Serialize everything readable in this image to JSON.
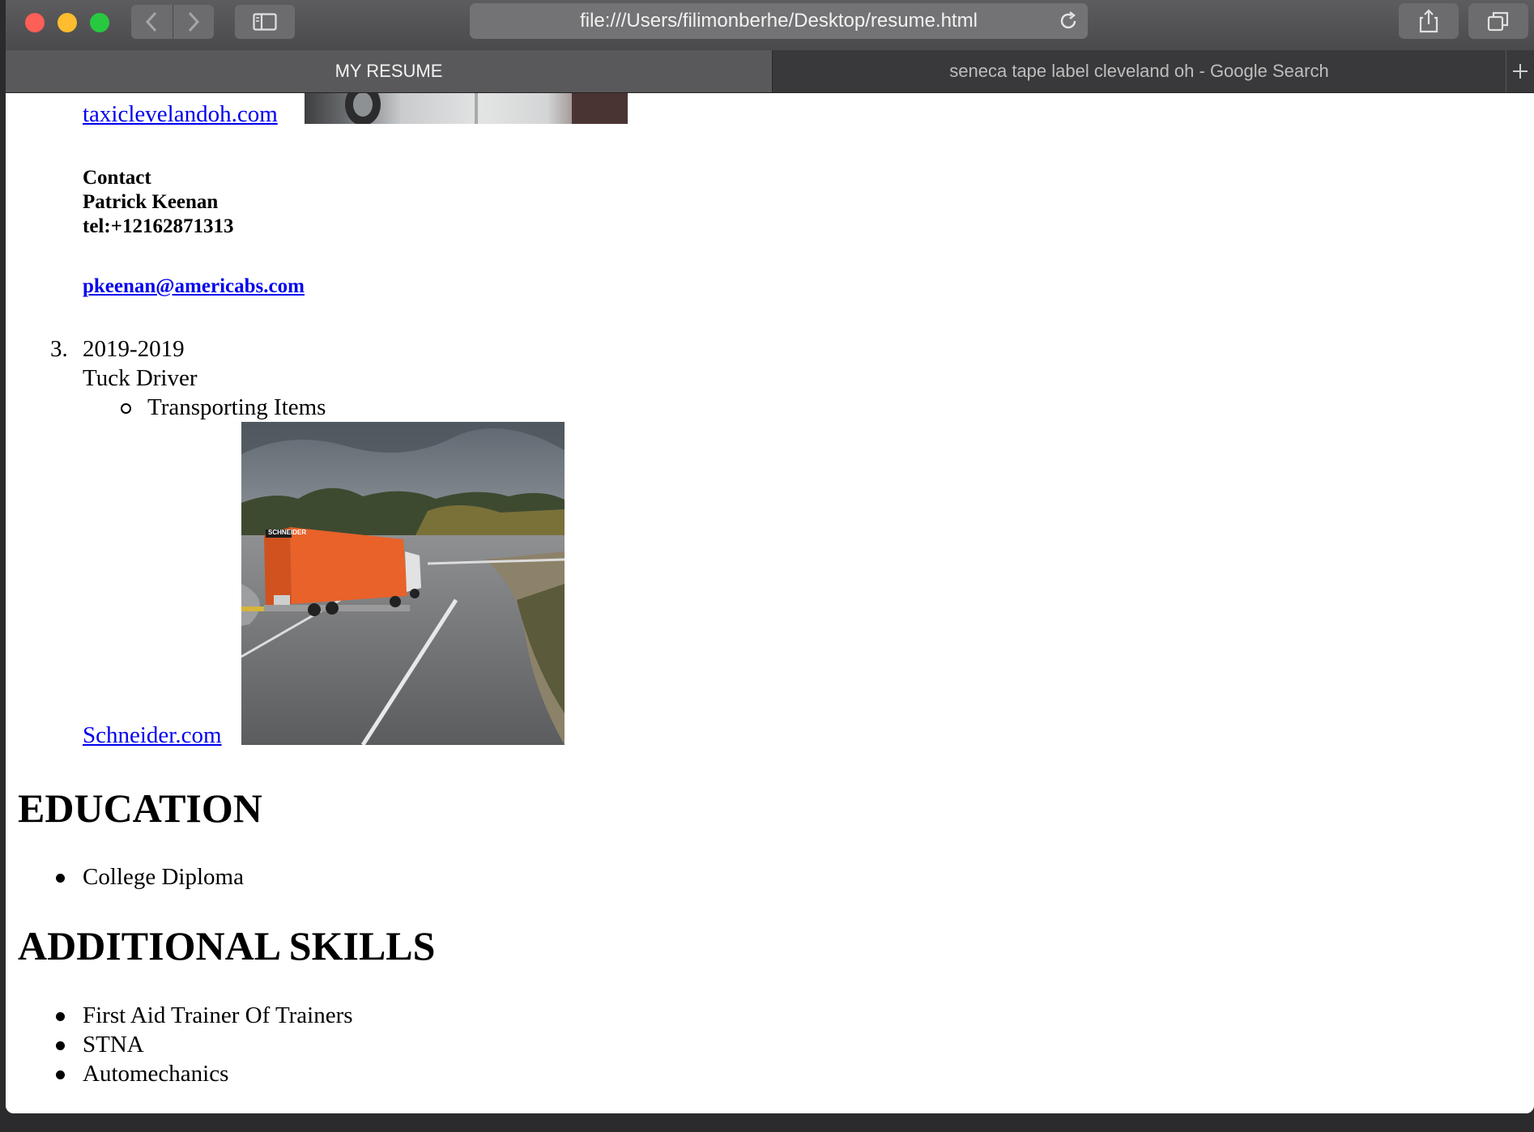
{
  "browser": {
    "url": "file:///Users/filimonberhe/Desktop/resume.html",
    "tabs": [
      {
        "label": "MY RESUME",
        "active": true
      },
      {
        "label": "seneca tape label cleveland oh - Google Search",
        "active": false
      }
    ]
  },
  "resume": {
    "job2": {
      "link": "taxiclevelandoh.com",
      "contact_heading": "Contact",
      "contact_name": "Patrick Keenan",
      "contact_tel": "tel:+12162871313",
      "contact_email": "pkeenan@americabs.com"
    },
    "job3": {
      "number": "3.",
      "years": "2019-2019",
      "title": "Tuck Driver",
      "duty": "Transporting Items",
      "link": "Schneider.com",
      "image_text": "SCHNEIDER"
    },
    "education": {
      "heading": "EDUCATION",
      "items": [
        "College Diploma"
      ]
    },
    "skills": {
      "heading": "ADDITIONAL SKILLS",
      "items": [
        "First Aid Trainer Of Trainers",
        "STNA",
        "Automechanics"
      ]
    }
  },
  "colors": {
    "link": "#0000ee",
    "truck_trailer": "#e8622a"
  }
}
